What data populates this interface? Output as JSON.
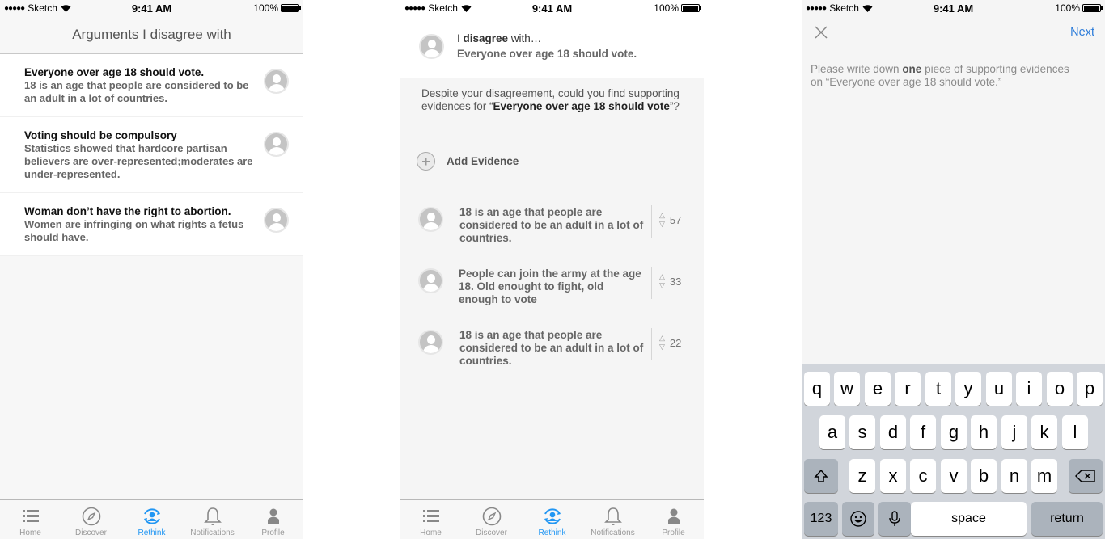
{
  "status_bar": {
    "carrier": "Sketch",
    "time": "9:41 AM",
    "battery": "100%"
  },
  "tabs": [
    {
      "label": "Home",
      "icon": "list-icon"
    },
    {
      "label": "Discover",
      "icon": "compass-icon"
    },
    {
      "label": "Rethink",
      "icon": "rethink-user-icon"
    },
    {
      "label": "Notifications",
      "icon": "bell-icon"
    },
    {
      "label": "Profile",
      "icon": "person-icon"
    }
  ],
  "screen1": {
    "title": "Arguments I disagree with",
    "arguments": [
      {
        "title": "Everyone over age 18 should vote.",
        "body": "18 is an age that people are considered to be an adult in a lot of countries."
      },
      {
        "title": "Voting should be compulsory",
        "body": "Statistics showed that hardcore partisan believers are over-represented;moderates are under-represented."
      },
      {
        "title": "Woman don’t have the right to abortion.",
        "body": "Women are infringing on what rights a fetus should have."
      }
    ]
  },
  "screen2": {
    "line1_pre": "I ",
    "line1_bold": "disagree",
    "line1_post": " with…",
    "argument": "Everyone over age 18 should vote.",
    "prompt_pre": "Despite your disagreement, could you find supporting evidences for “",
    "prompt_bold": "Everyone over age 18 should vote",
    "prompt_post": "”?",
    "add_evidence": "Add Evidence",
    "evidence": [
      {
        "text": "18 is an age that people are considered to be an adult in a lot of countries.",
        "votes": "57"
      },
      {
        "text": "People can join the army at the age 18. Old enought to fight, old enough to vote",
        "votes": "33"
      },
      {
        "text": "18 is an age that people are considered to be an adult in a lot of countries.",
        "votes": "22"
      }
    ]
  },
  "screen3": {
    "next": "Next",
    "prompt_pre": "Please write down ",
    "prompt_bold": "one",
    "prompt_post": " piece of supporting evidences on “Everyone over age 18 should vote.”",
    "keyboard": {
      "row1": [
        "q",
        "w",
        "e",
        "r",
        "t",
        "y",
        "u",
        "i",
        "o",
        "p"
      ],
      "row2": [
        "a",
        "s",
        "d",
        "f",
        "g",
        "h",
        "j",
        "k",
        "l"
      ],
      "row3": [
        "z",
        "x",
        "c",
        "v",
        "b",
        "n",
        "m"
      ],
      "numbers": "123",
      "space": "space",
      "return": "return"
    }
  }
}
